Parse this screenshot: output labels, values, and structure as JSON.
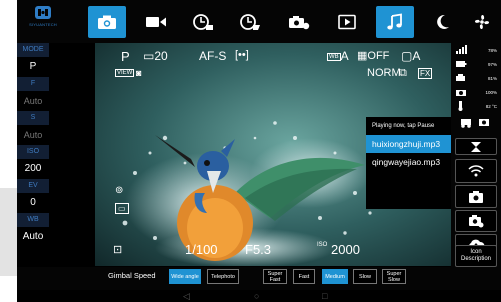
{
  "logo": {
    "text": "SIYUANTECH"
  },
  "topbar": {
    "buttons": [
      {
        "name": "photo-mode-button",
        "icon": "camera-icon"
      },
      {
        "name": "video-mode-button",
        "icon": "video-camera-icon"
      },
      {
        "name": "timelapse-button",
        "icon": "timer-icon"
      },
      {
        "name": "timer-video-button",
        "icon": "timer-record-icon"
      },
      {
        "name": "camera-timer-button",
        "icon": "camera-clock-icon"
      },
      {
        "name": "play-button",
        "icon": "play-icon"
      },
      {
        "name": "music-button",
        "icon": "music-note-icon"
      },
      {
        "name": "night-mode-button",
        "icon": "moon-z-icon"
      },
      {
        "name": "fan-button",
        "icon": "fan-icon"
      }
    ],
    "active": "music-button",
    "accent": "#1f93d3"
  },
  "left": {
    "mode_label": "MODE",
    "mode_value": "P",
    "f_label": "F",
    "f_value": "Auto",
    "s_label": "S",
    "s_value": "Auto",
    "iso_label": "ISO",
    "iso_value": "200",
    "ev_label": "EV",
    "ev_value": "0",
    "wb_label": "WB",
    "wb_value": "Auto"
  },
  "viewfinder": {
    "mode": "P",
    "shots": "20",
    "af": "AF-S",
    "metering": "[••]",
    "wb": "A",
    "drive": "OFF",
    "area": "A",
    "quality": "NORM",
    "fx": "FX",
    "view": "VIEW",
    "shutter": "1/100",
    "aperture": "F5.3",
    "iso": "2000"
  },
  "playlist": {
    "title": "Playing now, tap Pause",
    "songs": [
      "huixiongzhuji.mp3",
      "qingwayejiao.mp3"
    ],
    "selected_index": 0
  },
  "status": {
    "signal": "78%",
    "battery1": "97%",
    "battery2": "81%",
    "battery3": "100%",
    "temp": "82 °C"
  },
  "right_buttons": {
    "icon_desc": "Icon Description"
  },
  "bottom": {
    "gimbal_label": "Gimbal Speed",
    "wide_angle": "Wide angle",
    "telephoto": "Telephoto",
    "super_fast": "Super Fast",
    "fast": "Fast",
    "medium": "Medium",
    "slow": "Slow",
    "super_slow": "Super Slow"
  },
  "nav": {
    "back": "◁",
    "home": "○",
    "recent": "□"
  }
}
